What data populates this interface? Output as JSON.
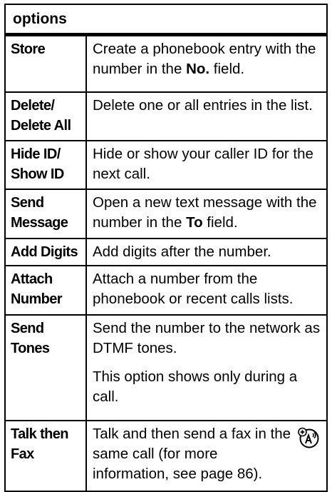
{
  "table": {
    "header": "options",
    "rows": [
      {
        "term1": "Store",
        "term2": "",
        "text_before": "Create a phonebook entry with the number in the ",
        "bold": "No.",
        "text_after": " field."
      },
      {
        "term1": "Delete/",
        "term2": "Delete All",
        "text": "Delete one or all entries in the list."
      },
      {
        "term1": "Hide ID/",
        "term2": "Show ID",
        "text": "Hide or show your caller ID for the next call."
      },
      {
        "term1": "Send",
        "term2": "Message",
        "text_before": "Open a new text message with the number in the ",
        "bold": "To",
        "text_after": " field."
      },
      {
        "term1": "Add Digits",
        "term2": "",
        "text": "Add digits after the number."
      },
      {
        "term1": "Attach",
        "term2": "Number",
        "text": "Attach a number from the phonebook or recent calls lists."
      },
      {
        "term1": "Send Tones",
        "term2": "",
        "text": "Send the number to the network as DTMF tones.",
        "text2": "This option shows only during a call."
      },
      {
        "term1": "Talk then",
        "term2": "Fax",
        "text": "Talk and then send a fax in the same call (for more information, see page 86).",
        "icon": "network-feature-icon"
      }
    ]
  }
}
